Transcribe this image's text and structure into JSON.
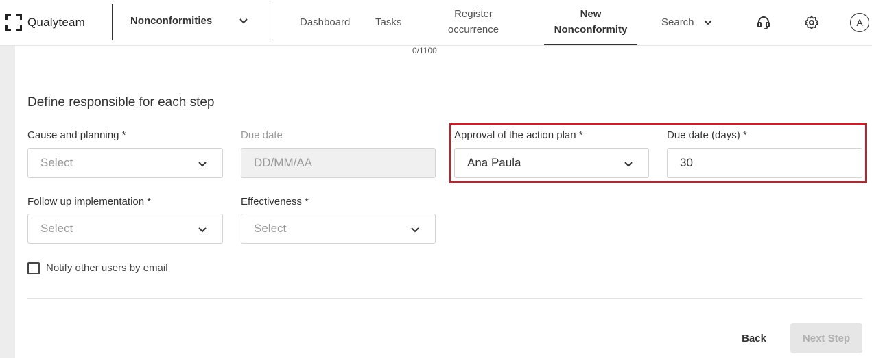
{
  "app": {
    "name": "Qualyteam",
    "module": "Nonconformities"
  },
  "nav": {
    "items": [
      {
        "label": "Dashboard"
      },
      {
        "label": "Tasks"
      },
      {
        "label": "Register occurrence"
      },
      {
        "label": "New Nonconformity",
        "active": true
      },
      {
        "label": "Search"
      }
    ]
  },
  "icons": {
    "support": "headset-icon",
    "settings": "gear-icon"
  },
  "user": {
    "initial": "A"
  },
  "form": {
    "char_counter": "0/1100",
    "section_title": "Define responsible for each step",
    "cause_planning": {
      "label": "Cause and planning *",
      "placeholder": "Select"
    },
    "due_date": {
      "label": "Due date",
      "placeholder": "DD/MM/AA"
    },
    "approval_action_plan": {
      "label": "Approval of the action plan *",
      "value": "Ana Paula"
    },
    "due_date_days": {
      "label": "Due date (days) *",
      "value": "30"
    },
    "follow_up": {
      "label": "Follow up implementation *",
      "placeholder": "Select"
    },
    "effectiveness": {
      "label": "Effectiveness *",
      "placeholder": "Select"
    },
    "notify": {
      "label": "Notify other users by email",
      "checked": false
    }
  },
  "footer": {
    "back_label": "Back",
    "next_label": "Next Step"
  },
  "colors": {
    "highlight": "#e0141e",
    "disabled_bg": "#e6e6e6",
    "text": "#333333"
  }
}
